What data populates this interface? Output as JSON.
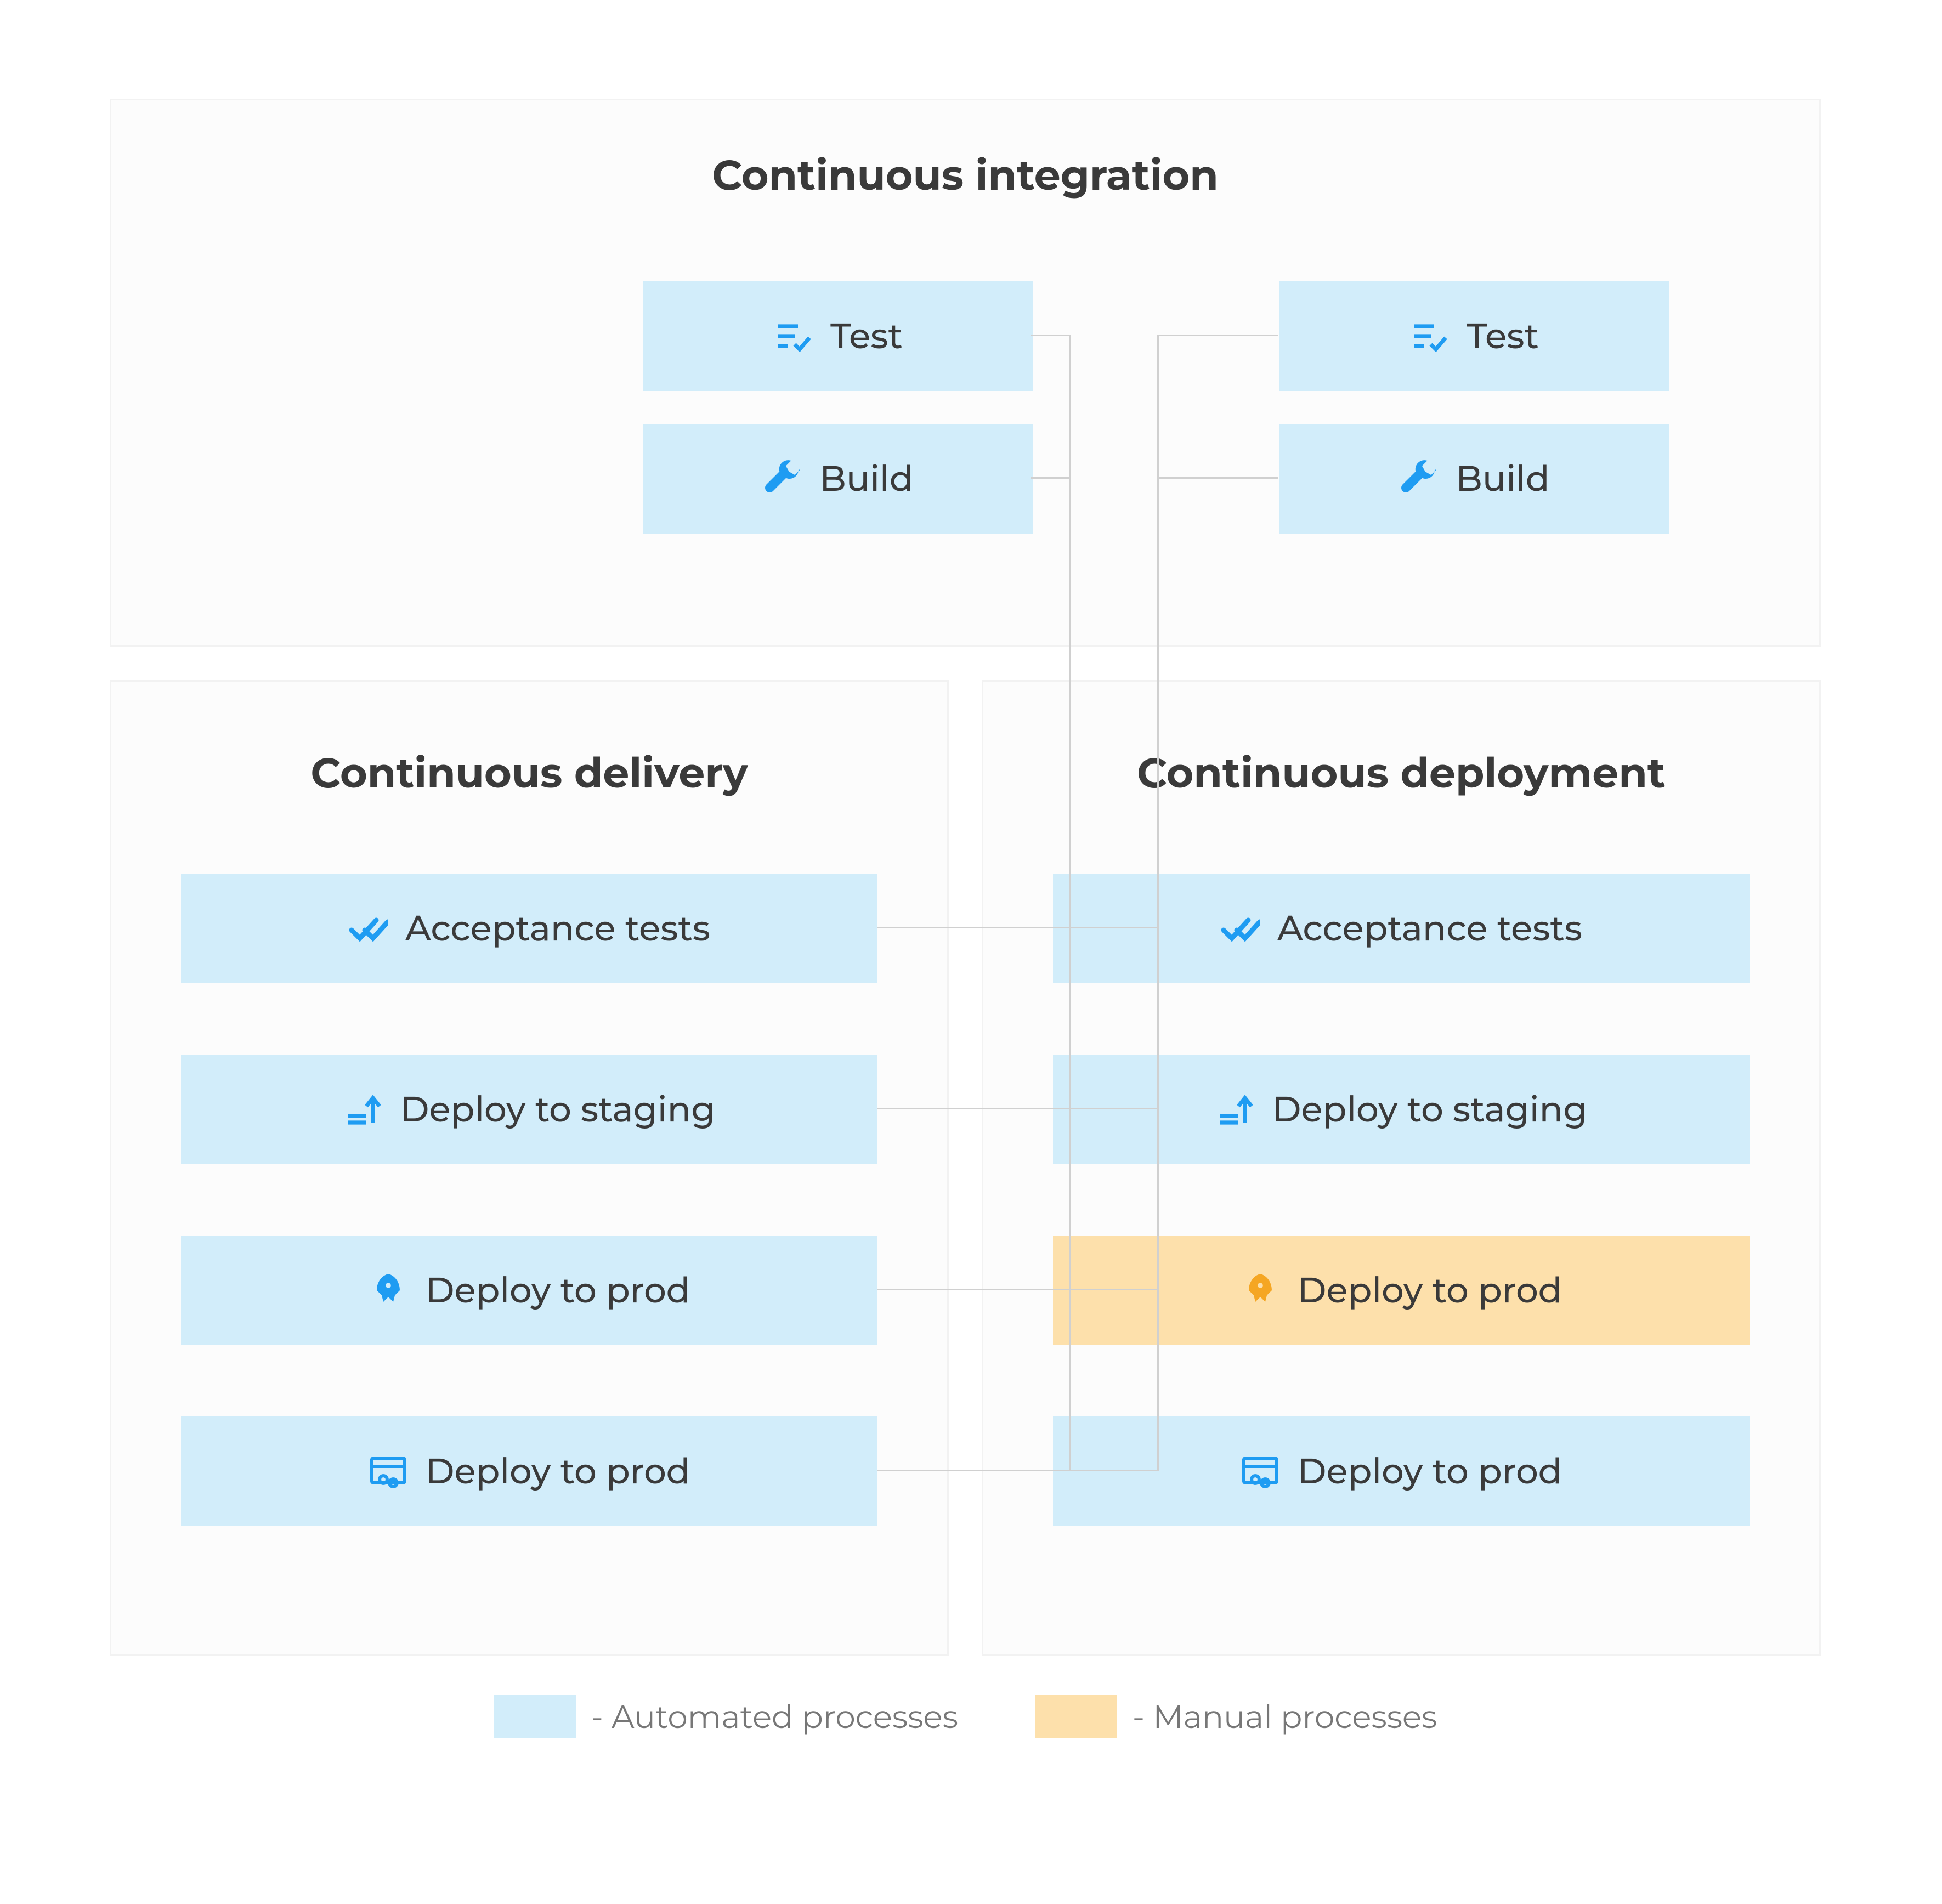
{
  "colors": {
    "automated": "#d2edfa",
    "manual": "#fde0ab",
    "icon_blue": "#1e9cf2",
    "icon_orange": "#f5a623"
  },
  "sections": {
    "ci": {
      "title": "Continuous integration",
      "columns": {
        "left": [
          {
            "label": "Test",
            "icon": "checklist",
            "variant": "automated"
          },
          {
            "label": "Build",
            "icon": "wrench",
            "variant": "automated"
          }
        ],
        "right": [
          {
            "label": "Test",
            "icon": "checklist",
            "variant": "automated"
          },
          {
            "label": "Build",
            "icon": "wrench",
            "variant": "automated"
          }
        ]
      }
    },
    "cdel": {
      "title": "Continuous delivery",
      "stages": [
        {
          "label": "Acceptance tests",
          "icon": "double-check",
          "variant": "automated"
        },
        {
          "label": "Deploy to staging",
          "icon": "upload-lines",
          "variant": "automated"
        },
        {
          "label": "Deploy to prod",
          "icon": "rocket",
          "variant": "automated"
        },
        {
          "label": "Deploy to prod",
          "icon": "browser-cog",
          "variant": "automated"
        }
      ]
    },
    "cdep": {
      "title": "Continuous deployment",
      "stages": [
        {
          "label": "Acceptance tests",
          "icon": "double-check",
          "variant": "automated"
        },
        {
          "label": "Deploy to staging",
          "icon": "upload-lines",
          "variant": "automated"
        },
        {
          "label": "Deploy to prod",
          "icon": "rocket",
          "variant": "manual"
        },
        {
          "label": "Deploy to prod",
          "icon": "browser-cog",
          "variant": "automated"
        }
      ]
    }
  },
  "legend": {
    "automated": "- Automated processes",
    "manual": "- Manual processes"
  }
}
